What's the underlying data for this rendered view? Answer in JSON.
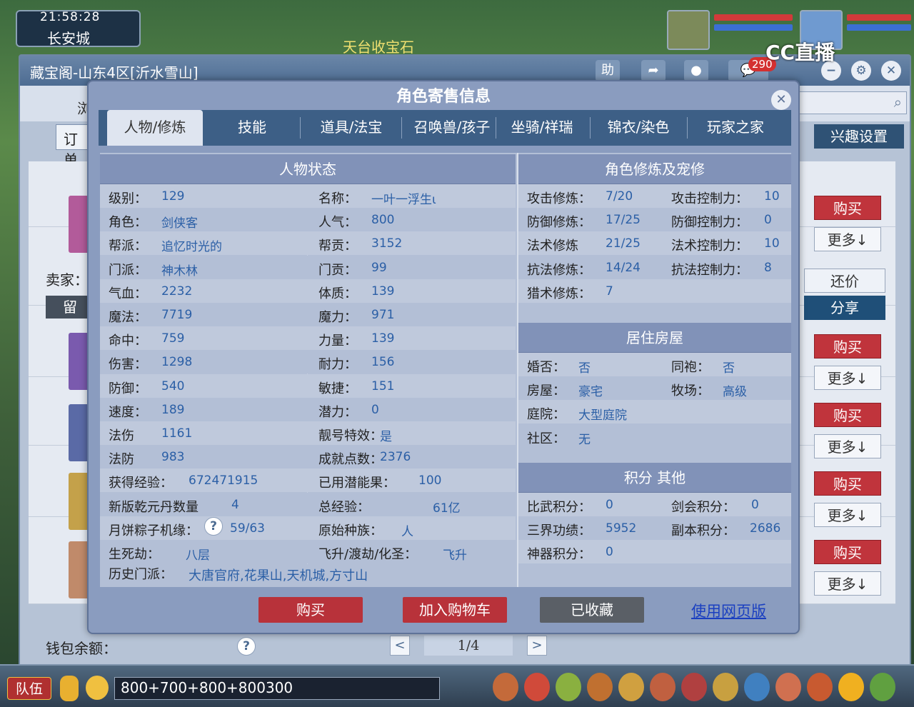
{
  "hud": {
    "clock": "21:58:28",
    "city": "长安城",
    "top_banner": "天台收宝石",
    "mail_count": "290",
    "stream_logo": "CC直播"
  },
  "outer": {
    "title": "藏宝阁-山东4区[沂水雪山]",
    "help": "助",
    "tab_label": "浏",
    "order_label": "订单",
    "interest_label": "兴趣设置",
    "seller_label": "卖家：",
    "leave_label": "留",
    "haggle_label": "还价",
    "share_label": "分享",
    "buy_label": "购买",
    "more_label": "更多↓",
    "wallet_label": "钱包余额：",
    "pager": "1/4",
    "prev": "<",
    "next": ">"
  },
  "modal": {
    "title": "角色寄售信息",
    "close": "✕",
    "tabs": [
      "人物/修炼",
      "技能",
      "道具/法宝",
      "召唤兽/孩子",
      "坐骑/祥瑞",
      "锦衣/染色",
      "玩家之家"
    ],
    "status_header": "人物状态",
    "cultivation_header": "角色修炼及宠修",
    "house_header": "居住房屋",
    "score_header": "积分 其他",
    "left_col": [
      {
        "label": "级别：",
        "value": "129"
      },
      {
        "label": "角色：",
        "value": "剑侠客"
      },
      {
        "label": "帮派：",
        "value": "追忆时光的"
      },
      {
        "label": "门派：",
        "value": "神木林"
      },
      {
        "label": "气血：",
        "value": "2232"
      },
      {
        "label": "魔法：",
        "value": "7719"
      },
      {
        "label": "命中：",
        "value": "759"
      },
      {
        "label": "伤害：",
        "value": "1298"
      },
      {
        "label": "防御：",
        "value": "540"
      },
      {
        "label": "速度：",
        "value": "189"
      },
      {
        "label": "法伤",
        "value": "1161"
      },
      {
        "label": "法防",
        "value": "983"
      },
      {
        "label": "获得经验：",
        "value": "672471915"
      },
      {
        "label": "新版乾元丹数量",
        "value": "4"
      },
      {
        "label": "月饼粽子机缘：",
        "value": "59/63"
      },
      {
        "label": "生死劫：",
        "value": "八层"
      }
    ],
    "mid_col": [
      {
        "label": "名称：",
        "value": "一叶一浮生ι"
      },
      {
        "label": "人气：",
        "value": "800"
      },
      {
        "label": "帮贡：",
        "value": "3152"
      },
      {
        "label": "门贡：",
        "value": "99"
      },
      {
        "label": "体质：",
        "value": "139"
      },
      {
        "label": "魔力：",
        "value": "971"
      },
      {
        "label": "力量：",
        "value": "139"
      },
      {
        "label": "耐力：",
        "value": "156"
      },
      {
        "label": "敏捷：",
        "value": "151"
      },
      {
        "label": "潜力：",
        "value": "0"
      },
      {
        "label": "靓号特效：",
        "value": "是"
      },
      {
        "label": "成就点数：",
        "value": "2376"
      },
      {
        "label": "已用潜能果：",
        "value": "100"
      },
      {
        "label": "总经验：",
        "value": "61亿"
      },
      {
        "label": "原始种族：",
        "value": "人"
      },
      {
        "label": "飞升/渡劫/化圣：",
        "value": "飞升"
      }
    ],
    "history_label": "历史门派：",
    "history_value": "大唐官府,花果山,天机城,方寸山",
    "cultivation": [
      {
        "label": "攻击修炼：",
        "value": "7/20",
        "label2": "攻击控制力：",
        "value2": "10"
      },
      {
        "label": "防御修炼：",
        "value": "17/25",
        "label2": "防御控制力：",
        "value2": "0"
      },
      {
        "label": "法术修炼",
        "value": "21/25",
        "label2": "法术控制力：",
        "value2": "10"
      },
      {
        "label": "抗法修炼：",
        "value": "14/24",
        "label2": "抗法控制力：",
        "value2": "8"
      },
      {
        "label": "猎术修炼：",
        "value": "7",
        "label2": "",
        "value2": ""
      }
    ],
    "house": [
      {
        "label": "婚否：",
        "value": "否",
        "label2": "同袍：",
        "value2": "否"
      },
      {
        "label": "房屋：",
        "value": "豪宅",
        "label2": "牧场：",
        "value2": "高级"
      },
      {
        "label": "庭院：",
        "value": "大型庭院",
        "label2": "",
        "value2": ""
      },
      {
        "label": "社区：",
        "value": "无",
        "label2": "",
        "value2": ""
      }
    ],
    "scores": [
      {
        "label": "比武积分：",
        "value": "0",
        "label2": "剑会积分：",
        "value2": "0"
      },
      {
        "label": "三界功绩：",
        "value": "5952",
        "label2": "副本积分：",
        "value2": "2686"
      },
      {
        "label": "神器积分：",
        "value": "0",
        "label2": "",
        "value2": ""
      }
    ],
    "buttons": {
      "buy": "购买",
      "add_cart": "加入购物车",
      "favorited": "已收藏",
      "web_link": "使用网页版"
    },
    "help_q": "?"
  },
  "bottom": {
    "team": "队伍",
    "chat_value": "800+700+800+800300"
  },
  "colors": {
    "buy_red": "#c0343c",
    "tab_bar": "#3d5f86",
    "value_blue": "#2b5fa6"
  }
}
